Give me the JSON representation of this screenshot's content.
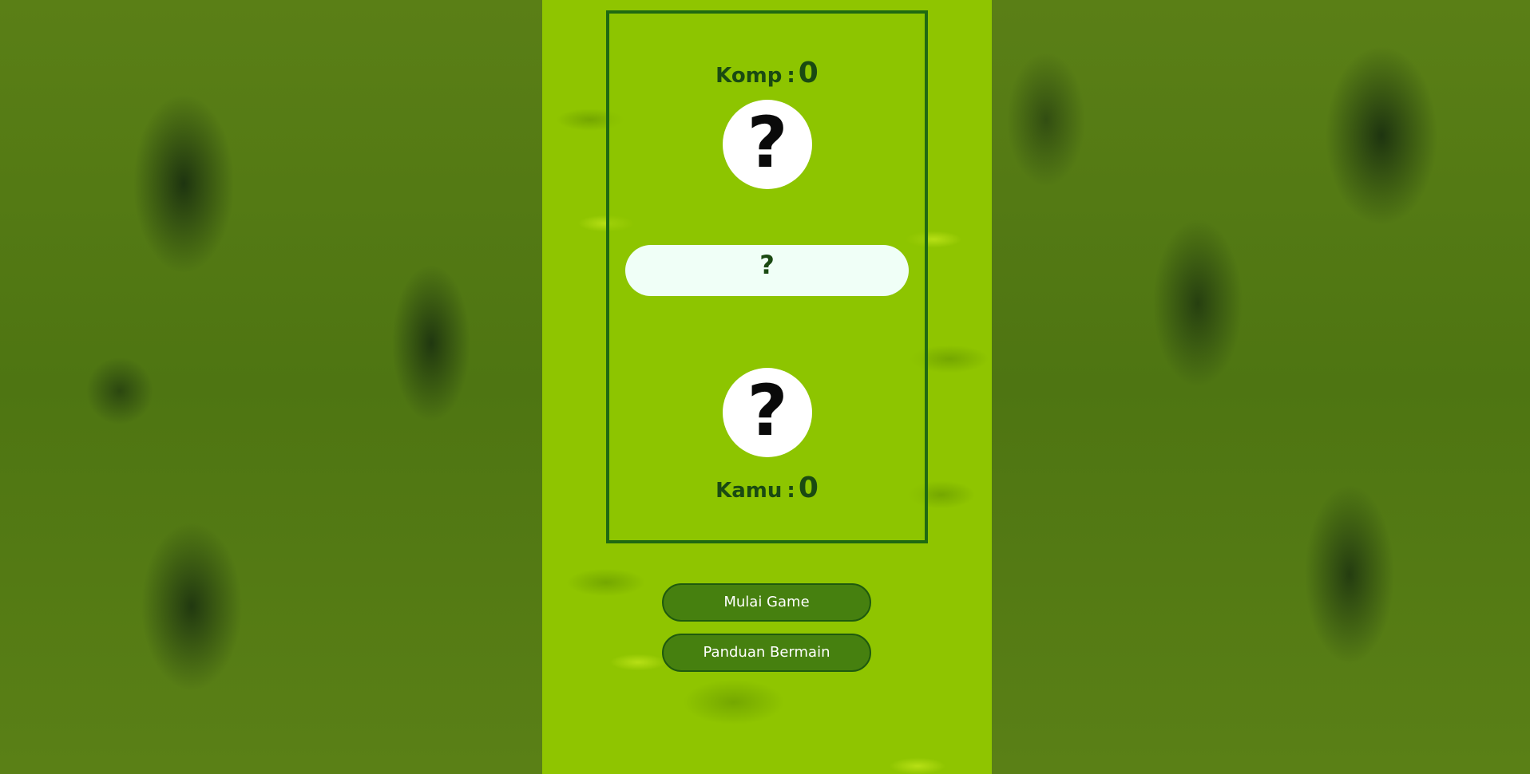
{
  "computer": {
    "label": "Komp",
    "separator": ":",
    "score": "0",
    "choice_icon": "question-mark-icon",
    "choice_symbol": "?"
  },
  "result": {
    "text": "?"
  },
  "player": {
    "label": "Kamu",
    "separator": ":",
    "score": "0",
    "choice_icon": "question-mark-icon",
    "choice_symbol": "?"
  },
  "buttons": {
    "start_label": "Mulai Game",
    "guide_label": "Panduan Bermain"
  },
  "colors": {
    "board_border": "#1f6a12",
    "text_dark_green": "#1a4a12",
    "button_bg": "#46800f",
    "game_bg": "#8fc500"
  }
}
